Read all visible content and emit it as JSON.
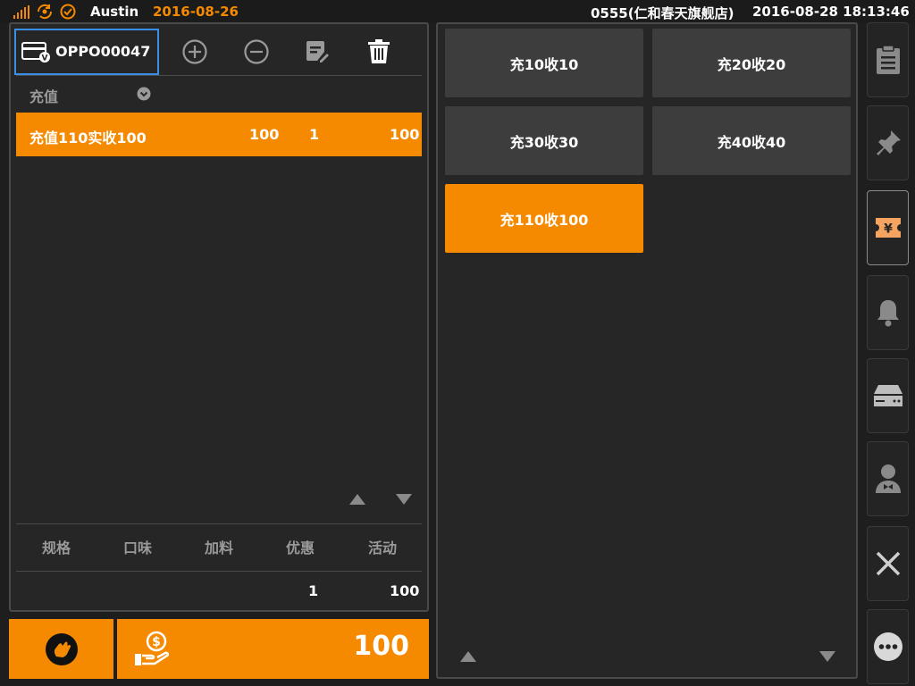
{
  "status": {
    "user": "Austin",
    "business_date": "2016-08-26",
    "store": "0555(仁和春天旗舰店)",
    "datetime": "2016-08-28 18:13:46"
  },
  "card": {
    "number": "OPPO00047"
  },
  "category": {
    "label": "充值"
  },
  "order_items": [
    {
      "name": "充值110实收100",
      "price": "100",
      "qty": "1",
      "amount": "100"
    }
  ],
  "detail_tabs": [
    "规格",
    "口味",
    "加料",
    "优惠",
    "活动"
  ],
  "totals": {
    "qty": "1",
    "amount": "100"
  },
  "pay": {
    "amount": "100"
  },
  "recharge_options": [
    "充10收10",
    "充20收20",
    "充30收30",
    "充40收40",
    "充110收100"
  ],
  "selected_option": "充110收100",
  "colors": {
    "accent": "#f58a00",
    "panel": "#262626",
    "button": "#3d3d3d"
  },
  "sidebar_icons": [
    "clipboard-icon",
    "pin-icon",
    "yuan-ticket-icon",
    "bell-icon",
    "drawer-icon",
    "waiter-icon",
    "close-icon",
    "more-icon"
  ]
}
